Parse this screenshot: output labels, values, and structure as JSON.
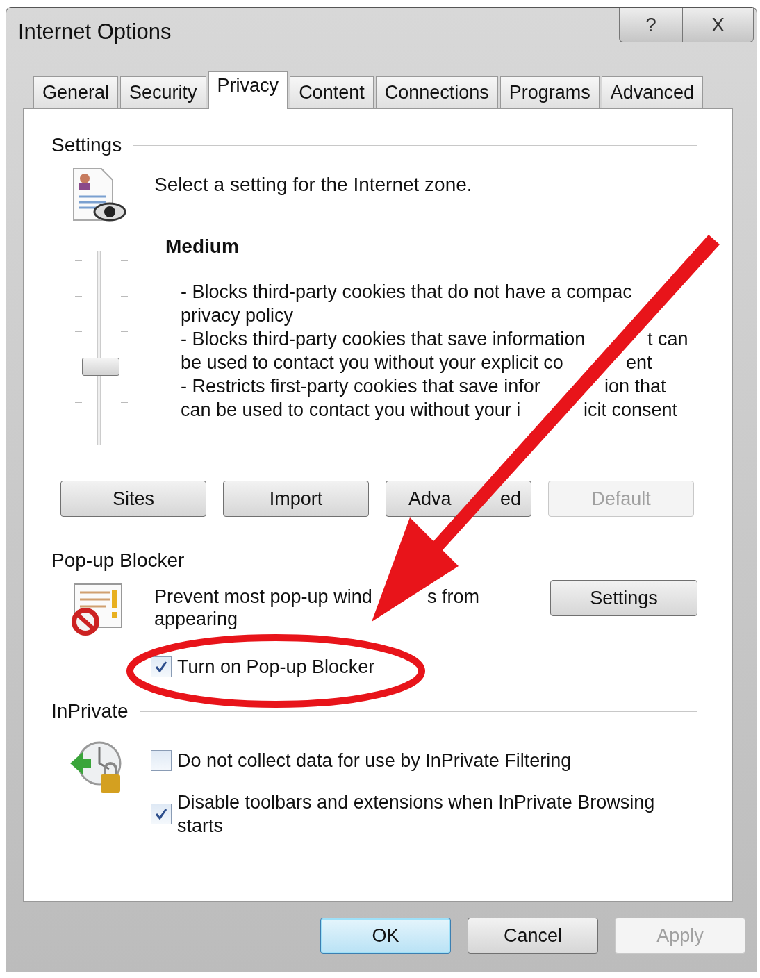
{
  "window": {
    "title": "Internet Options",
    "help_button": "?",
    "close_button": "X"
  },
  "tabs": [
    {
      "label": "General",
      "selected": false
    },
    {
      "label": "Security",
      "selected": false
    },
    {
      "label": "Privacy",
      "selected": true
    },
    {
      "label": "Content",
      "selected": false
    },
    {
      "label": "Connections",
      "selected": false
    },
    {
      "label": "Programs",
      "selected": false
    },
    {
      "label": "Advanced",
      "selected": false
    }
  ],
  "settings": {
    "heading": "Settings",
    "intro": "Select a setting for the Internet zone.",
    "slider": {
      "level": 0.4
    },
    "level_name": "Medium",
    "description_lines": [
      [
        "- Blocks third-party cookies that do not have a compac"
      ],
      [
        "privacy policy"
      ],
      [
        "- Blocks third-party cookies that save information",
        "t can"
      ],
      [
        "be used to contact you without your explicit co",
        "ent"
      ],
      [
        "- Restricts first-party cookies that save infor",
        "ion that"
      ],
      [
        "can be used to contact you without your i",
        "icit consent"
      ]
    ],
    "buttons": [
      {
        "label": "Sites",
        "disabled": false
      },
      {
        "label": "Import",
        "disabled": false
      },
      {
        "label_parts": [
          "Adva",
          "ed"
        ],
        "disabled": false
      },
      {
        "label": "Default",
        "disabled": true
      }
    ]
  },
  "popup_blocker": {
    "heading": "Pop-up Blocker",
    "text_parts": [
      "Prevent most pop-up wind",
      "s from"
    ],
    "text_line_2": "appearing",
    "settings_button": {
      "label": "Settings"
    },
    "checkbox": {
      "label": "Turn on Pop-up Blocker",
      "checked": true
    }
  },
  "inprivate": {
    "heading": "InPrivate",
    "checkboxes": [
      {
        "label": "Do not collect data for use by InPrivate Filtering",
        "checked": false
      },
      {
        "label": "Disable toolbars and extensions when InPrivate Browsing starts",
        "checked": true
      }
    ]
  },
  "footer_buttons": [
    {
      "label": "OK",
      "default": true,
      "disabled": false
    },
    {
      "label": "Cancel",
      "default": false,
      "disabled": false
    },
    {
      "label": "Apply",
      "default": false,
      "disabled": true
    }
  ]
}
